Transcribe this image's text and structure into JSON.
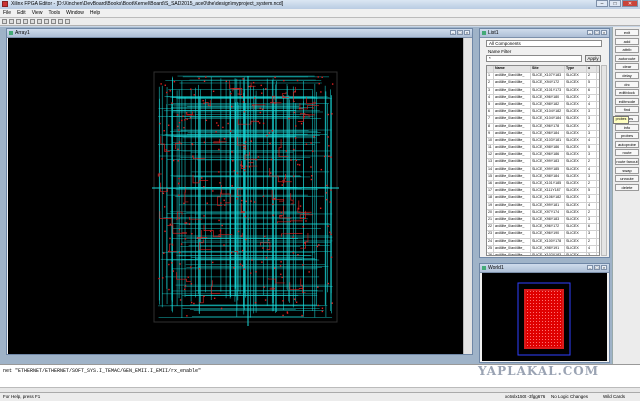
{
  "app": {
    "title": "Xilinx FPGA Editor - [D:\\Xinchen\\DevBoard\\Books\\Boot\\Kernel\\Board\\S_SAD2015_ace0\\the\\design\\myproject_system.ncd]"
  },
  "window_buttons": {
    "minimize": "–",
    "maximize": "□",
    "close": "✕"
  },
  "menu": [
    "File",
    "Edit",
    "View",
    "Tools",
    "Window",
    "Help"
  ],
  "array_window": {
    "title": "Array1"
  },
  "list_window": {
    "title": "List1",
    "filter_combo": "All Components",
    "name_filter_label": "Name Filter",
    "name_filter_value": "*",
    "apply_label": "Apply",
    "columns": [
      "",
      "Name",
      "Site",
      "Type",
      "o"
    ],
    "rows": [
      [
        "1",
        "axi4lite_0/axi4lite_",
        "SLICE_X107Y183",
        "SLICEX",
        "2"
      ],
      [
        "2",
        "axi4lite_0/axi4lite_",
        "SLICE_X94Y172",
        "SLICEX",
        "5"
      ],
      [
        "3",
        "axi4lite_0/axi4lite_",
        "SLICE_X101Y173",
        "SLICEX",
        "6"
      ],
      [
        "4",
        "axi4lite_0/axi4lite_",
        "SLICE_X96Y180",
        "SLICEX",
        "2"
      ],
      [
        "5",
        "axi4lite_0/axi4lite_",
        "SLICE_X98Y182",
        "SLICEX",
        "4"
      ],
      [
        "6",
        "axi4lite_0/axi4lite_",
        "SLICE_X104Y182",
        "SLICEX",
        "3"
      ],
      [
        "7",
        "axi4lite_0/axi4lite_",
        "SLICE_X104Y184",
        "SLICEX",
        "3"
      ],
      [
        "8",
        "axi4lite_0/axi4lite_",
        "SLICE_X96Y178",
        "SLICEX",
        "2"
      ],
      [
        "9",
        "axi4lite_0/axi4lite_",
        "SLICE_X96Y184",
        "SLICEX",
        "3"
      ],
      [
        "10",
        "axi4lite_0/axi4lite_",
        "SLICE_X103Y181",
        "SLICEX",
        "4"
      ],
      [
        "11",
        "axi4lite_0/axi4lite_",
        "SLICE_X98Y186",
        "SLICEX",
        "5"
      ],
      [
        "12",
        "axi4lite_0/axi4lite_",
        "SLICE_X96Y186",
        "SLICEX",
        "3"
      ],
      [
        "13",
        "axi4lite_0/axi4lite_",
        "SLICE_X99Y183",
        "SLICEX",
        "2"
      ],
      [
        "14",
        "axi4lite_0/axi4lite_",
        "SLICE_X99Y185",
        "SLICEX",
        "4"
      ],
      [
        "15",
        "axi4lite_0/axi4lite_",
        "SLICE_X98Y184",
        "SLICEX",
        "3"
      ],
      [
        "16",
        "axi4lite_0/axi4lite_",
        "SLICE_X101Y185",
        "SLICEX",
        "2"
      ],
      [
        "17",
        "axi4lite_0/axi4lite_",
        "SLICE_X111Y187",
        "SLICEX",
        "5"
      ],
      [
        "18",
        "axi4lite_0/axi4lite_",
        "SLICE_X106Y182",
        "SLICEX",
        "3"
      ],
      [
        "19",
        "axi4lite_0/axi4lite_",
        "SLICE_X99Y181",
        "SLICEX",
        "4"
      ],
      [
        "20",
        "axi4lite_0/axi4lite_",
        "SLICE_X97Y174",
        "SLICEX",
        "2"
      ],
      [
        "21",
        "axi4lite_0/axi4lite_",
        "SLICE_X98Y183",
        "SLICEX",
        "3"
      ],
      [
        "22",
        "axi4lite_0/axi4lite_",
        "SLICE_X96Y172",
        "SLICEX",
        "6"
      ],
      [
        "23",
        "axi4lite_0/axi4lite_",
        "SLICE_X96Y190",
        "SLICEX",
        "3"
      ],
      [
        "24",
        "axi4lite_0/axi4lite_",
        "SLICE_X100Y178",
        "SLICEX",
        "2"
      ],
      [
        "25",
        "axi4lite_0/axi4lite_",
        "SLICE_X98Y191",
        "SLICEX",
        "4"
      ],
      [
        "26",
        "axi4lite_0/axi4lite_",
        "SLICE_X102Y183",
        "SLICEX",
        "3"
      ],
      [
        "27",
        "axi4lite_0/axi4lite_",
        "SLICE_X98Y191",
        "SLICEX",
        "2"
      ],
      [
        "28",
        "axi4lite_0/axi4lite_",
        "SLICE_X97Y171",
        "SLICEX",
        "3"
      ]
    ]
  },
  "world_window": {
    "title": "World1"
  },
  "side_buttons": [
    "exit",
    "add",
    "attrib",
    "autoroute",
    "clear",
    "delay",
    "drc",
    "editblock",
    "editmode",
    "find",
    "probes",
    "info",
    "probes",
    "autoprobe",
    "route",
    "route fanout",
    "swap",
    "unroute",
    "delete"
  ],
  "tooltip": "probes",
  "console": {
    "text": "net \"ETHERNET/ETHERNET/SOFT_SYS.I_TEMAC/GEN_EMII.I_EMII/rx_enable\""
  },
  "status": {
    "left": "For Help, press F1",
    "device": "xc6slx150t -3fgg676",
    "logic": "No Logic Changes",
    "mode": "Wild Cards"
  },
  "watermark": "YAPLAKAL.COM",
  "colors": {
    "routing": "#19d9d9",
    "logic": "#e02020",
    "canvas": "#000000",
    "world_block": "#ff2020"
  }
}
